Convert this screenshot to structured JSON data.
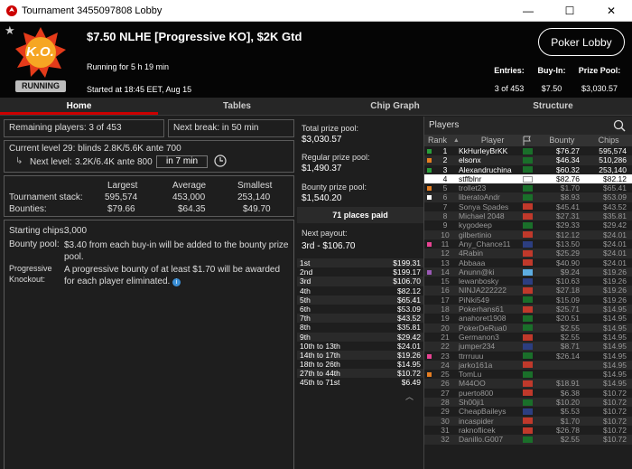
{
  "window": {
    "title": "Tournament 3455097808 Lobby",
    "min": "—",
    "max": "☐",
    "close": "✕"
  },
  "header": {
    "logo_text": "K.O.",
    "status": "RUNNING",
    "name": "$7.50 NLHE [Progressive KO], $2K Gtd",
    "running_for": "Running for 5 h 19 min",
    "started": "Started at 18:45 EET, Aug 15",
    "lobby_button": "Poker Lobby",
    "entries_label": "Entries:",
    "entries_value": "3 of 453",
    "buyin_label": "Buy-In:",
    "buyin_value": "$7.50",
    "prizepool_label": "Prize Pool:",
    "prizepool_value": "$3,030.57"
  },
  "tabs": [
    "Home",
    "Tables",
    "Chip Graph",
    "Structure"
  ],
  "home": {
    "remaining": "Remaining players: 3 of 453",
    "next_break": "Next break: in 50 min",
    "current_level": "Current level 29:  blinds 2.8K/5.6K ante 700",
    "next_level_label": "Next level:",
    "next_level_value": "3.2K/6.4K ante 800",
    "next_level_time": "in 7 min",
    "stats_headers": [
      "Largest",
      "Average",
      "Smallest"
    ],
    "stack_label": "Tournament stack:",
    "stack_values": [
      "595,574",
      "453,000",
      "253,140"
    ],
    "bounty_label": "Bounties:",
    "bounty_values": [
      "$79.66",
      "$64.35",
      "$49.70"
    ],
    "starting_chips_label": "Starting chips:",
    "starting_chips_value": "3,000",
    "bounty_pool_label": "Bounty pool:",
    "bounty_pool_value": "$3.40 from each buy-in will be added to the bounty prize pool.",
    "pko_label1": "Progressive",
    "pko_label2": "Knockout:",
    "pko_value": "A progressive bounty of at least $1.70 will be awarded for each player eliminated."
  },
  "prizes": {
    "total_label": "Total prize pool:",
    "total_value": "$3,030.57",
    "regular_label": "Regular prize pool:",
    "regular_value": "$1,490.37",
    "bounty_label": "Bounty prize pool:",
    "bounty_value": "$1,540.20",
    "places_paid": "71 places paid",
    "next_payout_label": "Next payout:",
    "next_payout_value": "3rd - $106.70",
    "rows": [
      [
        "1st",
        "$199.31"
      ],
      [
        "2nd",
        "$199.17"
      ],
      [
        "3rd",
        "$106.70"
      ],
      [
        "4th",
        "$82.12"
      ],
      [
        "5th",
        "$65.41"
      ],
      [
        "6th",
        "$53.09"
      ],
      [
        "7th",
        "$43.52"
      ],
      [
        "8th",
        "$35.81"
      ],
      [
        "9th",
        "$29.42"
      ],
      [
        "10th to 13th",
        "$24.01"
      ],
      [
        "14th to 17th",
        "$19.26"
      ],
      [
        "18th to 26th",
        "$14.95"
      ],
      [
        "27th to 44th",
        "$10.72"
      ],
      [
        "45th to 71st",
        "$6.49"
      ]
    ]
  },
  "players": {
    "title": "Players",
    "columns": [
      "Rank",
      "Player",
      "Bounty",
      "Chips"
    ],
    "rows": [
      [
        "1",
        "KkHurleyBrKK",
        "$76.27",
        "595,574",
        "#2a9d3a",
        "#1a6f2a"
      ],
      [
        "2",
        "elsonx",
        "$46.34",
        "510,286",
        "#e67e22",
        "#1a6f2a"
      ],
      [
        "3",
        "Alexandruchina",
        "$60.32",
        "253,140",
        "#2a9d3a",
        "#1a6f2a"
      ],
      [
        "4",
        "stffblnr",
        "$82.76",
        "$82.12",
        "",
        "#ffffff"
      ],
      [
        "5",
        "trollet23",
        "$1.70",
        "$65.41",
        "#e67e22",
        "#1a6f2a"
      ],
      [
        "6",
        "liberatoAndr",
        "$8.93",
        "$53.09",
        "#ffffff",
        "#1a6f2a"
      ],
      [
        "7",
        "Sonya Spades",
        "$45.41",
        "$43.52",
        "",
        "#c0392b"
      ],
      [
        "8",
        "Michael 2048",
        "$27.31",
        "$35.81",
        "",
        "#c0392b"
      ],
      [
        "9",
        "kygodeep",
        "$29.33",
        "$29.42",
        "",
        "#1a6f2a"
      ],
      [
        "10",
        "gilbertinio",
        "$12.12",
        "$24.01",
        "",
        "#c0392b"
      ],
      [
        "11",
        "Any_Chance11",
        "$13.50",
        "$24.01",
        "#e84393",
        "#2c3e80"
      ],
      [
        "12",
        "4Rabin",
        "$25.29",
        "$24.01",
        "",
        "#c0392b"
      ],
      [
        "13",
        "Abbaaa",
        "$40.90",
        "$24.01",
        "",
        "#c0392b"
      ],
      [
        "14",
        "Anunn@ki",
        "$9.24",
        "$19.26",
        "#9b59b6",
        "#5dade2"
      ],
      [
        "15",
        "lewanbosky",
        "$10.63",
        "$19.26",
        "",
        "#2c3e80"
      ],
      [
        "16",
        "NINJA222222",
        "$27.18",
        "$19.26",
        "",
        "#c0392b"
      ],
      [
        "17",
        "PiNki549",
        "$15.09",
        "$19.26",
        "",
        "#1a6f2a"
      ],
      [
        "18",
        "Pokerhans61",
        "$25.71",
        "$14.95",
        "",
        "#c0392b"
      ],
      [
        "19",
        "anahoret1908",
        "$20.51",
        "$14.95",
        "",
        "#1a6f2a"
      ],
      [
        "20",
        "PokerDeRua0",
        "$2.55",
        "$14.95",
        "",
        "#1a6f2a"
      ],
      [
        "21",
        "Germanon3",
        "$2.55",
        "$14.95",
        "",
        "#c0392b"
      ],
      [
        "22",
        "jumper234",
        "$8.71",
        "$14.95",
        "",
        "#2c3e80"
      ],
      [
        "23",
        "ttrrruuu",
        "$26.14",
        "$14.95",
        "#e84393",
        "#1a6f2a"
      ],
      [
        "24",
        "jarko161a",
        "",
        "$14.95",
        "",
        "#c0392b"
      ],
      [
        "25",
        "TomLu",
        "",
        "$14.95",
        "#e67e22",
        "#1a6f2a"
      ],
      [
        "26",
        "M44OO",
        "$18.91",
        "$14.95",
        "",
        "#c0392b"
      ],
      [
        "27",
        "puerto800",
        "$6.38",
        "$10.72",
        "",
        "#c0392b"
      ],
      [
        "28",
        "Sh00ji1",
        "$10.20",
        "$10.72",
        "",
        "#1a6f2a"
      ],
      [
        "29",
        "CheapBaileys",
        "$5.53",
        "$10.72",
        "",
        "#2c3e80"
      ],
      [
        "30",
        "incaspider",
        "$1.70",
        "$10.72",
        "",
        "#c0392b"
      ],
      [
        "31",
        "raknoflicek",
        "$26.78",
        "$10.72",
        "",
        "#c0392b"
      ],
      [
        "32",
        "Danillo.G007",
        "$2.55",
        "$10.72",
        "",
        "#1a6f2a"
      ]
    ]
  }
}
